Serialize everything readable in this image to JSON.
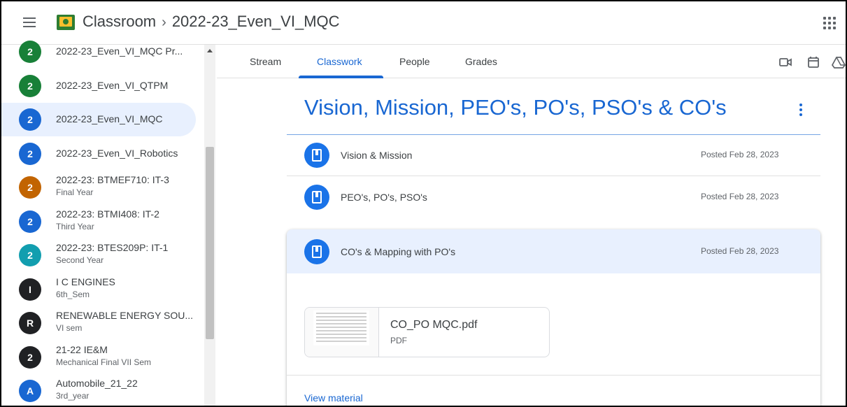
{
  "header": {
    "app_name": "Classroom",
    "separator": "›",
    "class_name": "2022-23_Even_VI_MQC"
  },
  "sidebar": {
    "items": [
      {
        "avatar": "2",
        "title": "2022-23_Even_VI_MQC Pr...",
        "subtitle": "",
        "color": "#188038"
      },
      {
        "avatar": "2",
        "title": "2022-23_Even_VI_QTPM",
        "subtitle": "",
        "color": "#188038"
      },
      {
        "avatar": "2",
        "title": "2022-23_Even_VI_MQC",
        "subtitle": "",
        "color": "#1967d2",
        "active": true
      },
      {
        "avatar": "2",
        "title": "2022-23_Even_VI_Robotics",
        "subtitle": "",
        "color": "#1967d2"
      },
      {
        "avatar": "2",
        "title": "2022-23: BTMEF710: IT-3",
        "subtitle": "Final Year",
        "color": "#c26401"
      },
      {
        "avatar": "2",
        "title": "2022-23: BTMI408: IT-2",
        "subtitle": "Third Year",
        "color": "#1967d2"
      },
      {
        "avatar": "2",
        "title": "2022-23: BTES209P: IT-1",
        "subtitle": "Second Year",
        "color": "#129eaf"
      },
      {
        "avatar": "I",
        "title": "I C ENGINES",
        "subtitle": "6th_Sem",
        "color": "#202124"
      },
      {
        "avatar": "R",
        "title": "RENEWABLE ENERGY SOU...",
        "subtitle": "VI sem",
        "color": "#202124"
      },
      {
        "avatar": "2",
        "title": "21-22 IE&M",
        "subtitle": "Mechanical Final VII Sem",
        "color": "#202124"
      },
      {
        "avatar": "A",
        "title": "Automobile_21_22",
        "subtitle": "3rd_year",
        "color": "#1967d2"
      }
    ]
  },
  "tabs": {
    "stream": "Stream",
    "classwork": "Classwork",
    "people": "People",
    "grades": "Grades",
    "active": "Classwork"
  },
  "toolbar_icons": [
    "meet-icon",
    "calendar-icon",
    "drive-icon"
  ],
  "topic": {
    "title": "Vision, Mission, PEO's, PO's, PSO's & CO's",
    "materials": [
      {
        "title": "Vision & Mission",
        "posted": "Posted Feb 28, 2023"
      },
      {
        "title": "PEO's, PO's, PSO's",
        "posted": "Posted Feb 28, 2023"
      },
      {
        "title": "CO's & Mapping with PO's",
        "posted": "Posted Feb 28, 2023",
        "expanded": true
      }
    ],
    "expanded_material": {
      "attachment_name": "CO_PO MQC.pdf",
      "attachment_type": "PDF",
      "view_link": "View material"
    }
  },
  "colors": {
    "accent": "#1967d2",
    "active_bg": "#e8f0fe"
  }
}
